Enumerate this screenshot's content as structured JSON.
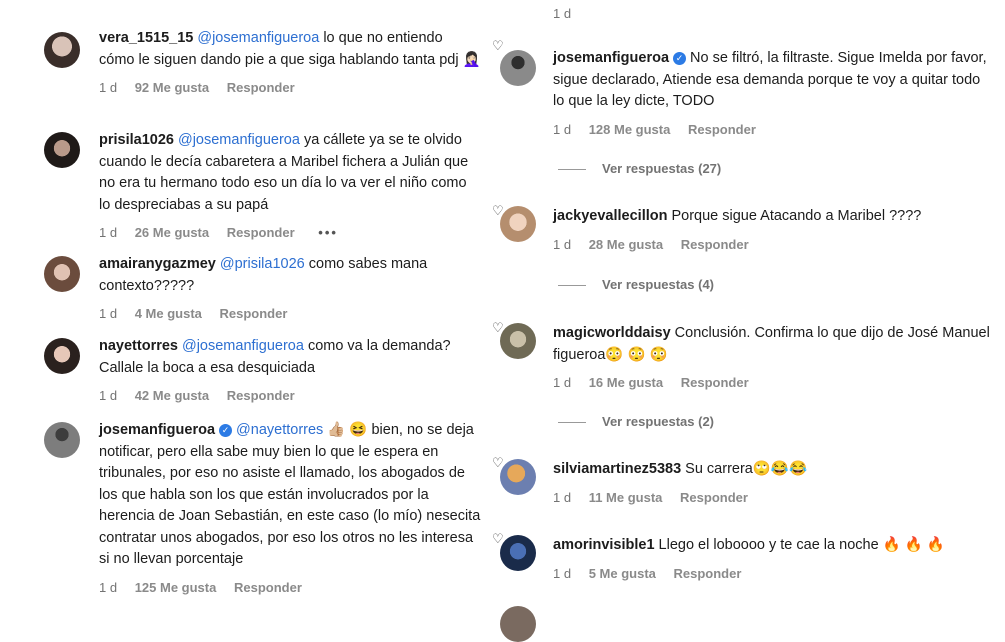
{
  "left_comments": [
    {
      "user": "vera_1515_15",
      "mention": "@josemanfigueroa",
      "text": " lo que no entiendo cómo le siguen dando pie a que siga hablando tanta pdj 🤦🏻‍♀️",
      "time": "1 d",
      "likes": "92 Me gusta",
      "reply": "Responder"
    },
    {
      "user": "prisila1026",
      "mention": "@josemanfigueroa",
      "text": " ya cállete ya se te olvido cuando le decía cabaretera a Maribel fichera a Julián que no era tu hermano todo eso un día lo va ver el niño como lo despreciabas a su papá",
      "time": "1 d",
      "likes": "26 Me gusta",
      "reply": "Responder",
      "more": "•••"
    },
    {
      "user": "amairanygazmey",
      "mention": "@prisila1026",
      "text": " como sabes mana contexto?????",
      "time": "1 d",
      "likes": "4 Me gusta",
      "reply": "Responder"
    },
    {
      "user": "nayettorres",
      "mention": "@josemanfigueroa",
      "text": " como va la demanda? Callale la boca a esa desquiciada",
      "time": "1 d",
      "likes": "42 Me gusta",
      "reply": "Responder"
    },
    {
      "user": "josemanfigueroa",
      "verified": true,
      "mention": "@nayettorres",
      "text": " 👍🏼 😆 bien, no se deja notificar, pero ella sabe muy bien lo que le espera en tribunales, por eso no asiste el llamado, los abogados de los que habla son los que están involucrados por la herencia de Joan Sebastián, en este caso (lo mío) nesecita contratar unos abogados, por eso los otros no les interesa si no llevan porcentaje",
      "time": "1 d",
      "likes": "125 Me gusta",
      "reply": "Responder"
    }
  ],
  "right_top_time": "1 d",
  "right_comments": [
    {
      "user": "josemanfigueroa",
      "verified": true,
      "mention": "",
      "text": "No se filtró, la filtraste. Sigue Imelda por favor, sigue declarado, Atiende esa demanda porque te voy a quitar todo lo que la ley dicte, TODO",
      "time": "1 d",
      "likes": "128 Me gusta",
      "reply": "Responder",
      "replies": "Ver respuestas (27)"
    },
    {
      "user": "jackyevallecillon",
      "mention": "",
      "text": "Porque sigue Atacando a Maribel ????",
      "time": "1 d",
      "likes": "28 Me gusta",
      "reply": "Responder",
      "replies": "Ver respuestas (4)"
    },
    {
      "user": "magicworlddaisy",
      "mention": "",
      "text": "Conclusión. Confirma lo que dijo de José Manuel figueroa😳 😳 😳",
      "time": "1 d",
      "likes": "16 Me gusta",
      "reply": "Responder",
      "replies": "Ver respuestas (2)"
    },
    {
      "user": "silviamartinez5383",
      "mention": "",
      "text": "Su carrera🙄😂😂",
      "time": "1 d",
      "likes": "11 Me gusta",
      "reply": "Responder"
    },
    {
      "user": "amorinvisible1",
      "mention": "",
      "text": "Llego el loboooo y te cae la noche 🔥 🔥 🔥",
      "time": "1 d",
      "likes": "5 Me gusta",
      "reply": "Responder"
    }
  ],
  "icons": {
    "like": "heart-icon",
    "verified": "verified-badge-icon"
  },
  "colors": {
    "mention": "#2d6fd1",
    "meta": "#737373",
    "verified": "#2c7be5"
  }
}
